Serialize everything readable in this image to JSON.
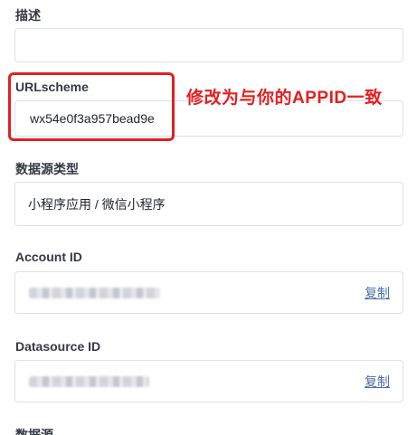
{
  "form": {
    "description": {
      "label": "描述",
      "value": ""
    },
    "url_scheme": {
      "label": "URLscheme",
      "value": "wx54e0f3a957bead9e"
    },
    "data_source_type": {
      "label": "数据源类型",
      "value": "小程序应用 / 微信小程序"
    },
    "account_id": {
      "label": "Account ID",
      "copy_label": "复制"
    },
    "datasource_id": {
      "label": "Datasource ID",
      "copy_label": "复制"
    },
    "next_label_cut": "数据源"
  },
  "annotation": {
    "text": "修改为与你的APPID一致",
    "color": "#e51f1f"
  },
  "colors": {
    "link": "#4a6ea8",
    "border": "#dce1e8",
    "highlight": "#e51f1f"
  }
}
